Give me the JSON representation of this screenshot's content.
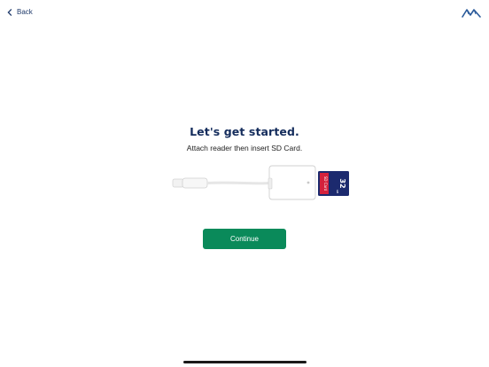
{
  "header": {
    "back_label": "Back",
    "back_icon": "chevron-left-icon",
    "logo_icon": "mountain-logo-icon"
  },
  "main": {
    "title": "Let's get started.",
    "subtitle": "Attach reader then insert SD Card.",
    "illustration": {
      "card_text": "SD Card",
      "card_capacity": "32",
      "card_capacity_unit": "GB"
    },
    "continue_label": "Continue"
  },
  "colors": {
    "accent_navy": "#142c5c",
    "button_green": "#0a8a5a",
    "sd_card_blue": "#1c2a6e",
    "sd_card_red": "#d5213c"
  }
}
